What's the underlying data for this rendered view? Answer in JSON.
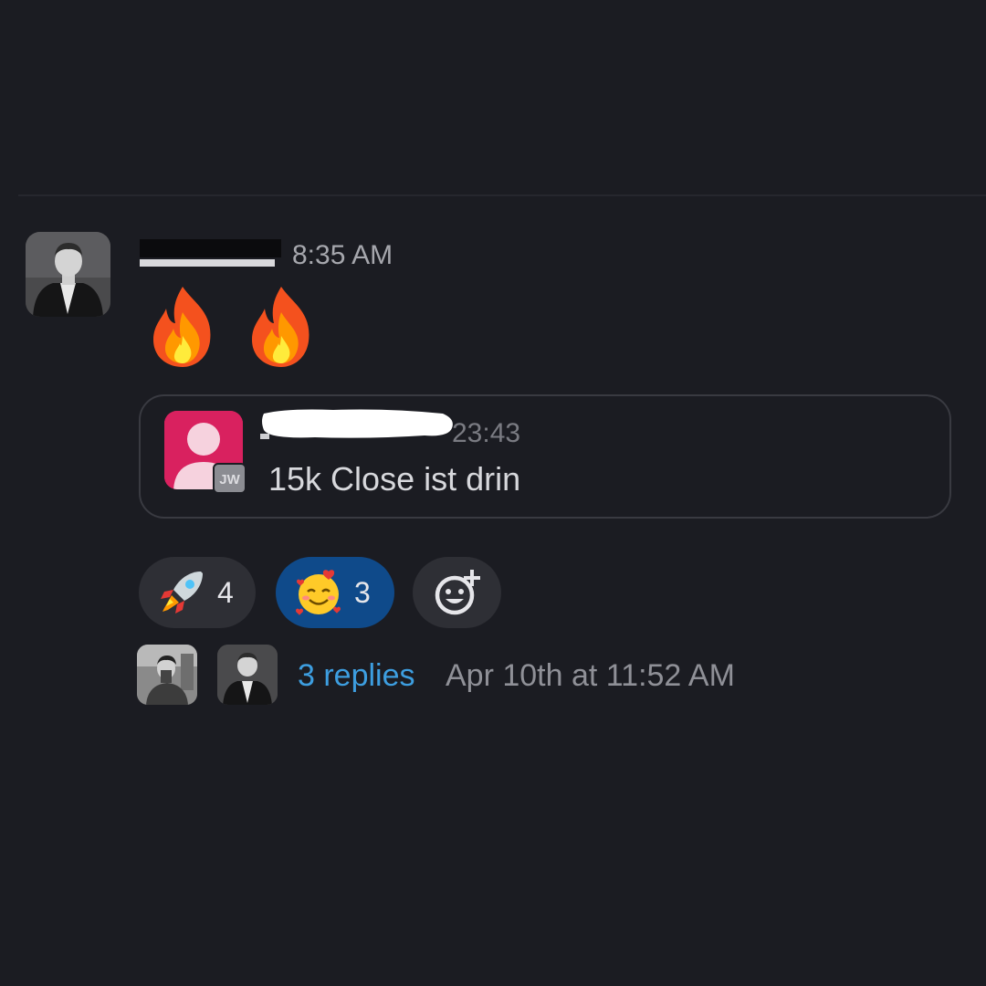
{
  "message": {
    "author_redacted": true,
    "time": "8:35 AM",
    "emojis": [
      "fire-emoji",
      "fire-emoji"
    ]
  },
  "quote": {
    "author_initials": "JW",
    "author_redacted": true,
    "time": "23:43",
    "text": "15k Close ist drin"
  },
  "reactions": [
    {
      "emoji": "rocket-emoji",
      "count": "4",
      "active": false
    },
    {
      "emoji": "smiling-face-with-hearts-emoji",
      "count": "3",
      "active": true
    },
    {
      "emoji": "add-reaction-icon",
      "count": "",
      "active": false
    }
  ],
  "thread": {
    "replies_label": "3 replies",
    "last_reply": "Apr 10th at 11:52 AM"
  },
  "colors": {
    "background": "#1b1c22",
    "link": "#3d9ee0",
    "active_reaction": "#0f4a8a",
    "quote_avatar": "#d9215f"
  }
}
